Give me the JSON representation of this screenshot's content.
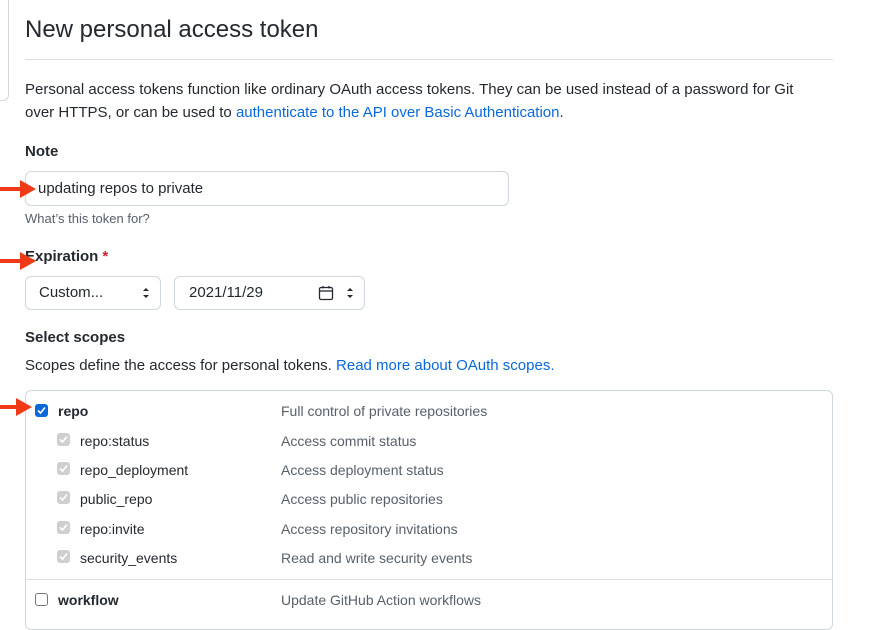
{
  "page": {
    "title": "New personal access token",
    "intro_text": "Personal access tokens function like ordinary OAuth access tokens. They can be used instead of a password for Git over HTTPS, or can be used to ",
    "intro_link": "authenticate to the API over Basic Authentication",
    "intro_end": "."
  },
  "note": {
    "label": "Note",
    "value": "updating repos to private",
    "hint": "What’s this token for?"
  },
  "expiration": {
    "label": "Expiration",
    "required_mark": "*",
    "select_value": "Custom...",
    "date_value": "2021/11/29"
  },
  "scopes": {
    "label": "Select scopes",
    "description": "Scopes define the access for personal tokens.",
    "link": "Read more about OAuth scopes.",
    "items": [
      {
        "name": "repo",
        "desc": "Full control of private repositories",
        "checked": true
      },
      {
        "name": "repo:status",
        "desc": "Access commit status",
        "checked": true
      },
      {
        "name": "repo_deployment",
        "desc": "Access deployment status",
        "checked": true
      },
      {
        "name": "public_repo",
        "desc": "Access public repositories",
        "checked": true
      },
      {
        "name": "repo:invite",
        "desc": "Access repository invitations",
        "checked": true
      },
      {
        "name": "security_events",
        "desc": "Read and write security events",
        "checked": true
      },
      {
        "name": "workflow",
        "desc": "Update GitHub Action workflows",
        "checked": false
      }
    ]
  },
  "colors": {
    "accent": "#0969da",
    "annotation_arrow": "#f03a17",
    "required": "#cf222e"
  }
}
